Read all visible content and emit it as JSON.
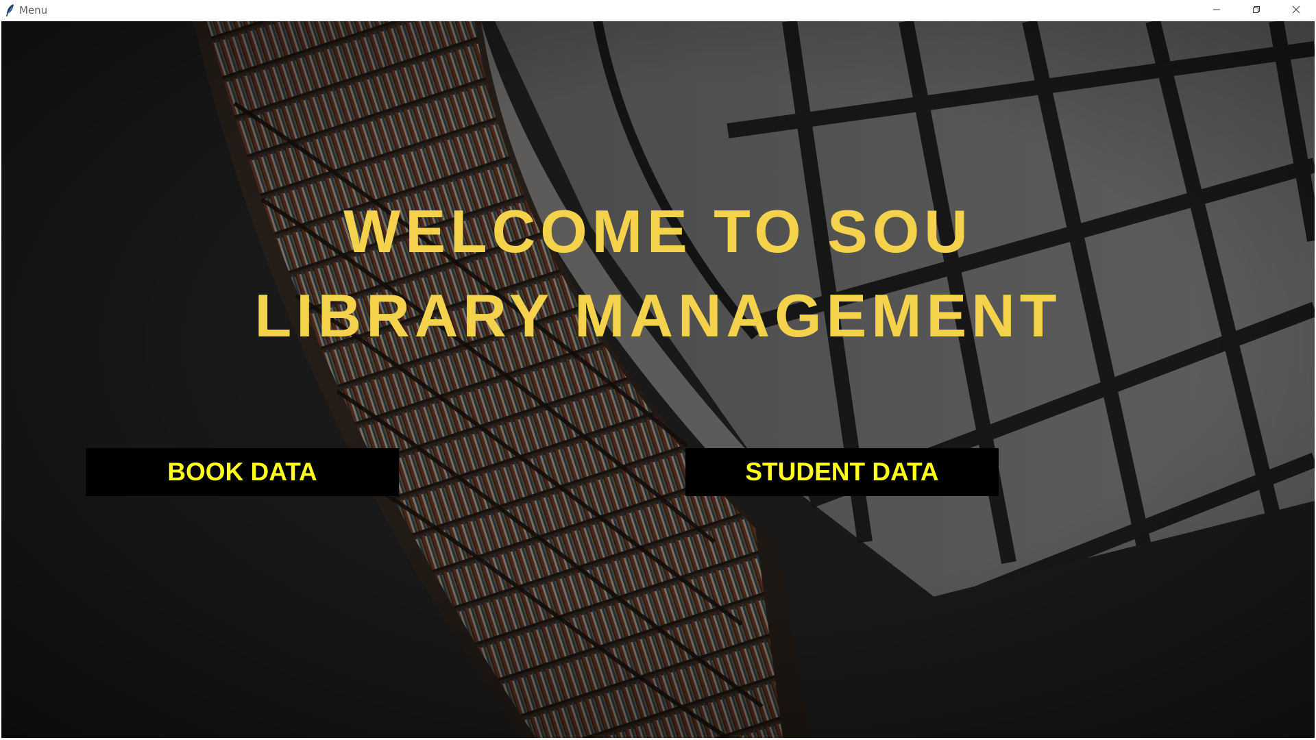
{
  "window": {
    "title": "Menu",
    "icon": "feather-icon",
    "controls": [
      "minimize-icon",
      "restore-icon",
      "close-icon"
    ]
  },
  "headline": {
    "line1": "WELCOME TO SOU",
    "line2": "LIBRARY MANAGEMENT"
  },
  "buttons": {
    "book_data": "BOOK DATA",
    "student_data": "STUDENT DATA"
  },
  "colors": {
    "headline": "#f4d24b",
    "button_text": "#ffff1a",
    "button_bg": "#000000",
    "background": "#2a2a2a"
  },
  "background_image": "library-bookshelves-photo"
}
